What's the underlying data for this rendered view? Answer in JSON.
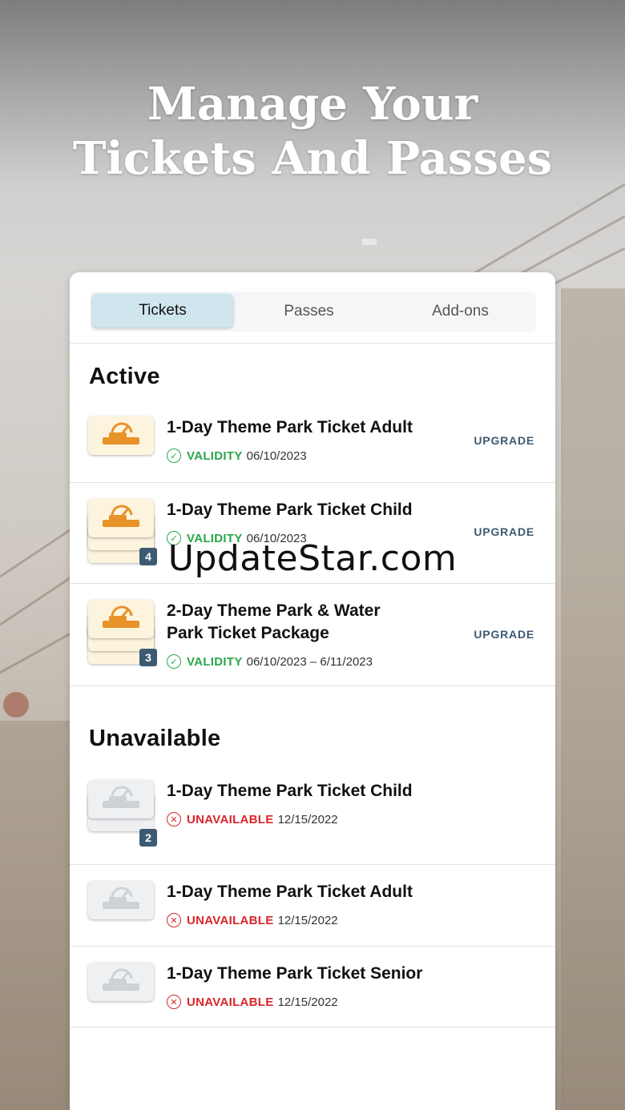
{
  "headline": {
    "line1": "Manage Your",
    "line2": "Tickets And Passes"
  },
  "tabs": [
    {
      "label": "Tickets",
      "active": true
    },
    {
      "label": "Passes",
      "active": false
    },
    {
      "label": "Add-ons",
      "active": false
    }
  ],
  "active_section": {
    "title": "Active",
    "items": [
      {
        "name": "1-Day Theme Park Ticket Adult",
        "status_label": "VALIDITY",
        "date": "06/10/2023",
        "action": "UPGRADE"
      },
      {
        "name": "1-Day Theme Park Ticket Child",
        "status_label": "VALIDITY",
        "date": "06/10/2023",
        "action": "UPGRADE",
        "count": "4"
      },
      {
        "name_line1": "2-Day Theme Park & Water",
        "name_line2": "Park Ticket Package",
        "status_label": "VALIDITY",
        "date": "06/10/2023 – 6/11/2023",
        "action": "UPGRADE",
        "count": "3"
      }
    ]
  },
  "unavailable_section": {
    "title": "Unavailable",
    "items": [
      {
        "name": "1-Day Theme Park Ticket Child",
        "status_label": "UNAVAILABLE",
        "date": "12/15/2022",
        "count": "2"
      },
      {
        "name": "1-Day Theme Park Ticket Adult",
        "status_label": "UNAVAILABLE",
        "date": "12/15/2022"
      },
      {
        "name": "1-Day Theme Park Ticket Senior",
        "status_label": "UNAVAILABLE",
        "date": "12/15/2022"
      }
    ]
  },
  "icons": {
    "ok": "check-circle-icon",
    "bad": "x-circle-icon",
    "ticket": "coaster-ticket-icon"
  },
  "colors": {
    "valid": "#2aa64a",
    "unavailable": "#d9262c",
    "accent": "#3d5a73",
    "active_tab": "#cfe6ee",
    "ticket_orange": "#e8922a"
  },
  "watermark": "UpdateStar.com"
}
